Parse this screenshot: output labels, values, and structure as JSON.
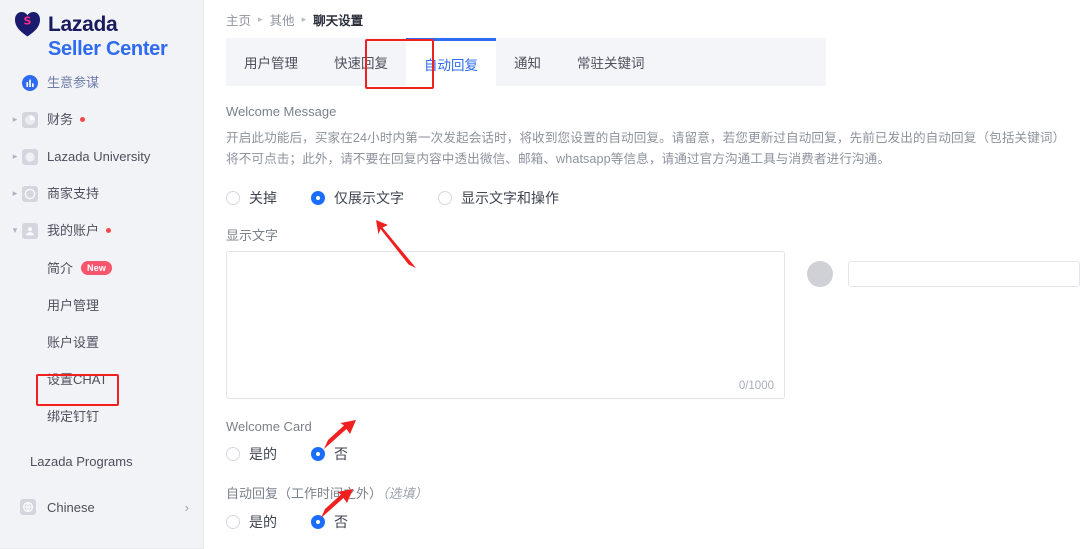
{
  "brand": {
    "name": "Lazada",
    "subtitle": "Seller Center",
    "logo_icon": "lazada-heart-logo",
    "navy": "#1a1a5e",
    "blue": "#2f6bf0",
    "pink": "#ff2d8a"
  },
  "sidebar": {
    "items": [
      {
        "label": "生意参谋",
        "icon": "chart-icon",
        "caret": "",
        "dot": false,
        "active": true
      },
      {
        "label": "财务",
        "icon": "pie-icon",
        "caret": "▸",
        "dot": true,
        "active": false
      },
      {
        "label": "Lazada University",
        "icon": "cap-icon",
        "caret": "▸",
        "dot": false,
        "active": false
      },
      {
        "label": "商家支持",
        "icon": "help-icon",
        "caret": "▸",
        "dot": false,
        "active": false
      },
      {
        "label": "我的账户",
        "icon": "account-icon",
        "caret": "▾",
        "dot": true,
        "active": false
      }
    ],
    "sub_items": [
      {
        "label": "简介",
        "badge": "New",
        "selected": false
      },
      {
        "label": "用户管理",
        "badge": "",
        "selected": false
      },
      {
        "label": "账户设置",
        "badge": "",
        "selected": false
      },
      {
        "label": "设置CHAT",
        "badge": "",
        "selected": true
      },
      {
        "label": "绑定钉钉",
        "badge": "",
        "selected": false
      }
    ],
    "programs_label": "Lazada Programs",
    "language": {
      "label": "Chinese",
      "icon": "globe-icon",
      "chevron": "›"
    }
  },
  "breadcrumb": {
    "items": [
      "主页",
      "其他",
      "聊天设置"
    ],
    "separator": "▸"
  },
  "tabs": [
    {
      "label": "用户管理",
      "active": false
    },
    {
      "label": "快速回复",
      "active": false
    },
    {
      "label": "自动回复",
      "active": true
    },
    {
      "label": "通知",
      "active": false
    },
    {
      "label": "常驻关键词",
      "active": false
    }
  ],
  "welcome_message": {
    "section_label": "Welcome Message",
    "description": "开启此功能后，买家在24小时内第一次发起会话时，将收到您设置的自动回复。请留意，若您更新过自动回复，先前已发出的自动回复（包括关键词）将不可点击；此外，请不要在回复内容中透出微信、邮箱、whatsapp等信息，请通过官方沟通工具与消费者进行沟通。",
    "mode_options": [
      {
        "label": "关掉",
        "checked": false
      },
      {
        "label": "仅展示文字",
        "checked": true
      },
      {
        "label": "显示文字和操作",
        "checked": false
      }
    ],
    "text_field_label": "显示文字",
    "textarea_value": "",
    "char_counter": "0/1000",
    "preview": {
      "avatar_icon": "avatar-placeholder",
      "input_value": ""
    }
  },
  "welcome_card": {
    "section_label": "Welcome Card",
    "options": [
      {
        "label": "是的",
        "checked": false
      },
      {
        "label": "否",
        "checked": true
      }
    ]
  },
  "auto_reply_offhours": {
    "section_label": "自动回复（工作时间之外）",
    "optional_note": "（选填）",
    "options": [
      {
        "label": "是的",
        "checked": false
      },
      {
        "label": "否",
        "checked": true
      }
    ]
  },
  "annotations": {
    "color": "#f02020",
    "boxes": [
      "setting-chat-sidebar-item",
      "auto-reply-tab"
    ],
    "arrows": [
      "arrow-to-text-only-radio",
      "arrow-to-welcome-card-no",
      "arrow-to-offhours-no"
    ]
  }
}
